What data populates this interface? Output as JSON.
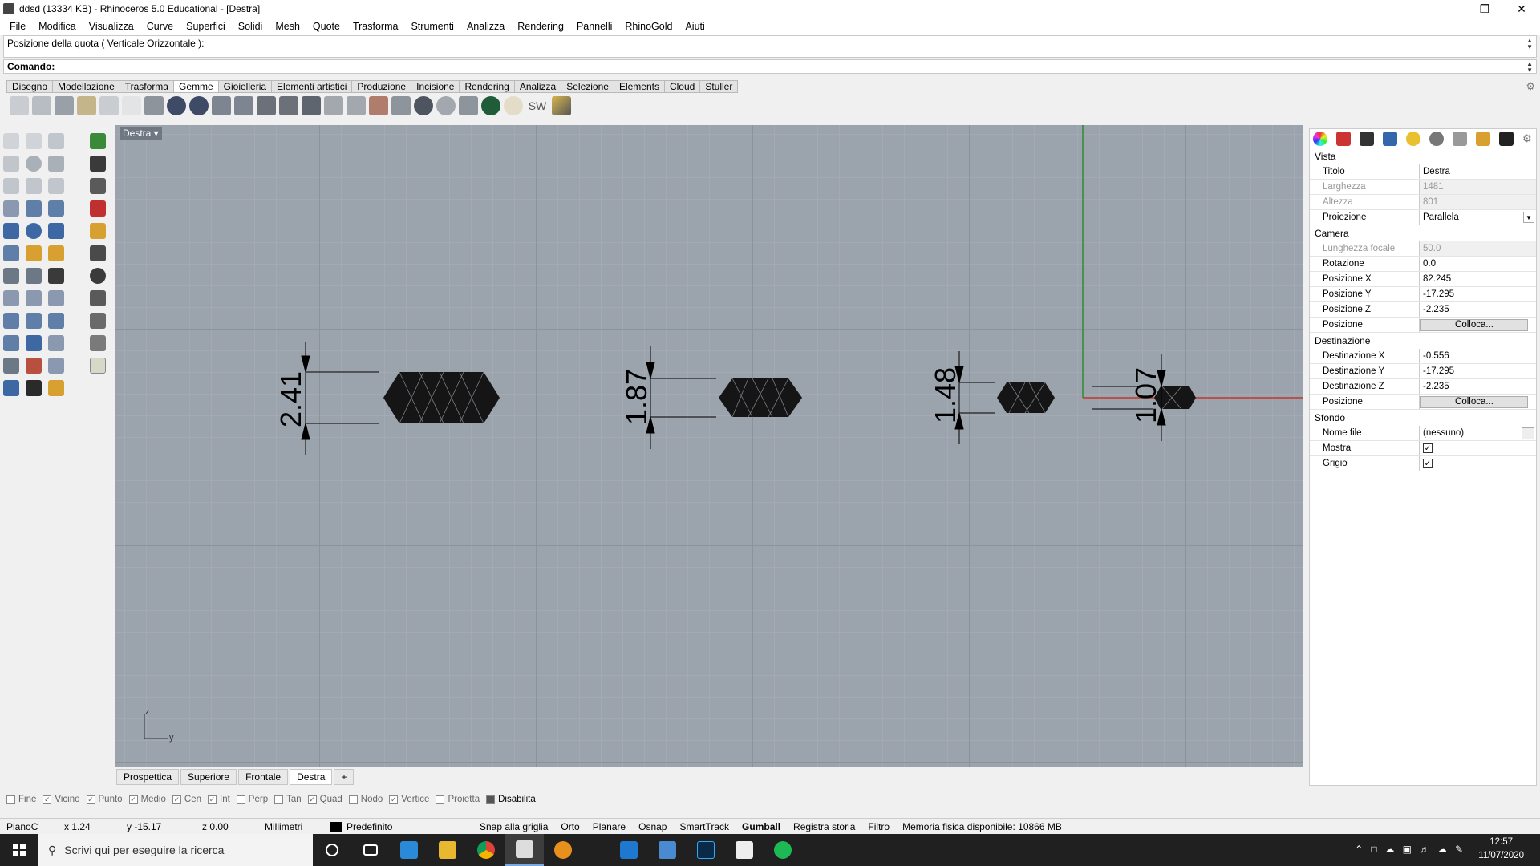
{
  "window": {
    "title": "ddsd (13334 KB) - Rhinoceros 5.0 Educational - [Destra]"
  },
  "menu": [
    "File",
    "Modifica",
    "Visualizza",
    "Curve",
    "Superfici",
    "Solidi",
    "Mesh",
    "Quote",
    "Trasforma",
    "Strumenti",
    "Analizza",
    "Rendering",
    "Pannelli",
    "RhinoGold",
    "Aiuti"
  ],
  "command": {
    "history": "Posizione della quota ( Verticale  Orizzontale ):",
    "prompt": "Comando:"
  },
  "toolbar_tabs": [
    "Disegno",
    "Modellazione",
    "Trasforma",
    "Gemme",
    "Gioielleria",
    "Elementi artistici",
    "Produzione",
    "Incisione",
    "Rendering",
    "Analizza",
    "Selezione",
    "Elements",
    "Cloud",
    "Stuller"
  ],
  "toolbar_text": "SW",
  "viewport": {
    "title": "Destra",
    "dimensions": [
      "2.41",
      "1.87",
      "1.48",
      "1.07"
    ],
    "axis_z": "z",
    "axis_y": "y"
  },
  "view_tabs": [
    "Prospettica",
    "Superiore",
    "Frontale",
    "Destra",
    "+"
  ],
  "osnaps": [
    {
      "label": "Fine",
      "checked": false
    },
    {
      "label": "Vicino",
      "checked": true
    },
    {
      "label": "Punto",
      "checked": true
    },
    {
      "label": "Medio",
      "checked": true
    },
    {
      "label": "Cen",
      "checked": true
    },
    {
      "label": "Int",
      "checked": true
    },
    {
      "label": "Perp",
      "checked": false
    },
    {
      "label": "Tan",
      "checked": false
    },
    {
      "label": "Quad",
      "checked": true
    },
    {
      "label": "Nodo",
      "checked": false
    },
    {
      "label": "Vertice",
      "checked": true
    },
    {
      "label": "Proietta",
      "checked": false
    },
    {
      "label": "Disabilita",
      "checked": false
    }
  ],
  "status": {
    "cplane": "PianoC",
    "x": "x 1.24",
    "y": "y -15.17",
    "z": "z 0.00",
    "units": "Millimetri",
    "layer": "Predefinito",
    "snap": "Snap alla griglia",
    "ortho": "Orto",
    "planar": "Planare",
    "osnap": "Osnap",
    "smarttrack": "SmartTrack",
    "gumball": "Gumball",
    "history": "Registra storia",
    "filter": "Filtro",
    "memory": "Memoria fisica disponibile: 10866 MB"
  },
  "props": {
    "vista": "Vista",
    "titolo_k": "Titolo",
    "titolo_v": "Destra",
    "larghezza_k": "Larghezza",
    "larghezza_v": "1481",
    "altezza_k": "Altezza",
    "altezza_v": "801",
    "proiezione_k": "Proiezione",
    "proiezione_v": "Parallela",
    "camera": "Camera",
    "focale_k": "Lunghezza focale",
    "focale_v": "50.0",
    "rotazione_k": "Rotazione",
    "rotazione_v": "0.0",
    "posx_k": "Posizione X",
    "posx_v": "82.245",
    "posy_k": "Posizione Y",
    "posy_v": "-17.295",
    "posz_k": "Posizione Z",
    "posz_v": "-2.235",
    "pos_k": "Posizione",
    "colloca": "Colloca...",
    "dest": "Destinazione",
    "destx_k": "Destinazione X",
    "destx_v": "-0.556",
    "desty_k": "Destinazione Y",
    "desty_v": "-17.295",
    "destz_k": "Destinazione Z",
    "destz_v": "-2.235",
    "sfondo": "Sfondo",
    "nomefile_k": "Nome file",
    "nomefile_v": "(nessuno)",
    "dots": "...",
    "mostra_k": "Mostra",
    "grigio_k": "Grigio"
  },
  "taskbar": {
    "search": "Scrivi qui per eseguire la ricerca",
    "time": "12:57",
    "date": "11/07/2020"
  },
  "colors": {
    "viewport_bg": "#9ba3ad",
    "x_axis": "#c0392b",
    "y_axis": "#2e8b2e"
  }
}
